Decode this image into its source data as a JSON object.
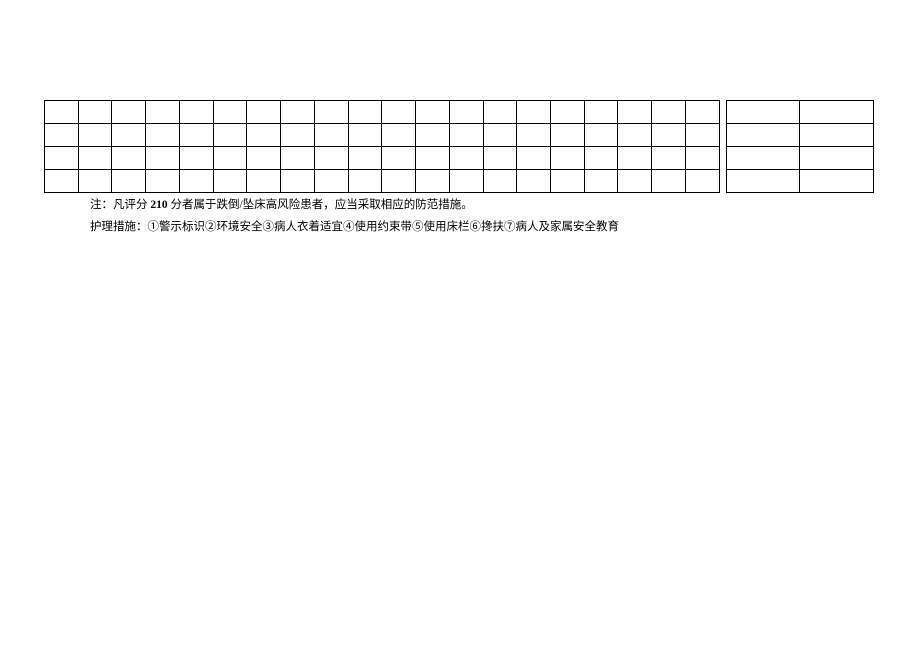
{
  "table": {
    "rows": 4,
    "narrow_cols": 20,
    "wide_cols": 2
  },
  "notes": {
    "line1_prefix": "注：凡评分 ",
    "line1_bold": "210",
    "line1_suffix": " 分者属于跌倒/坠床高风险患者，应当采取相应的防范措施。",
    "line2": "护理措施：①警示标识②环境安全③病人衣着适宜④使用约束带⑤使用床栏⑥搀扶⑦病人及家属安全教育"
  }
}
